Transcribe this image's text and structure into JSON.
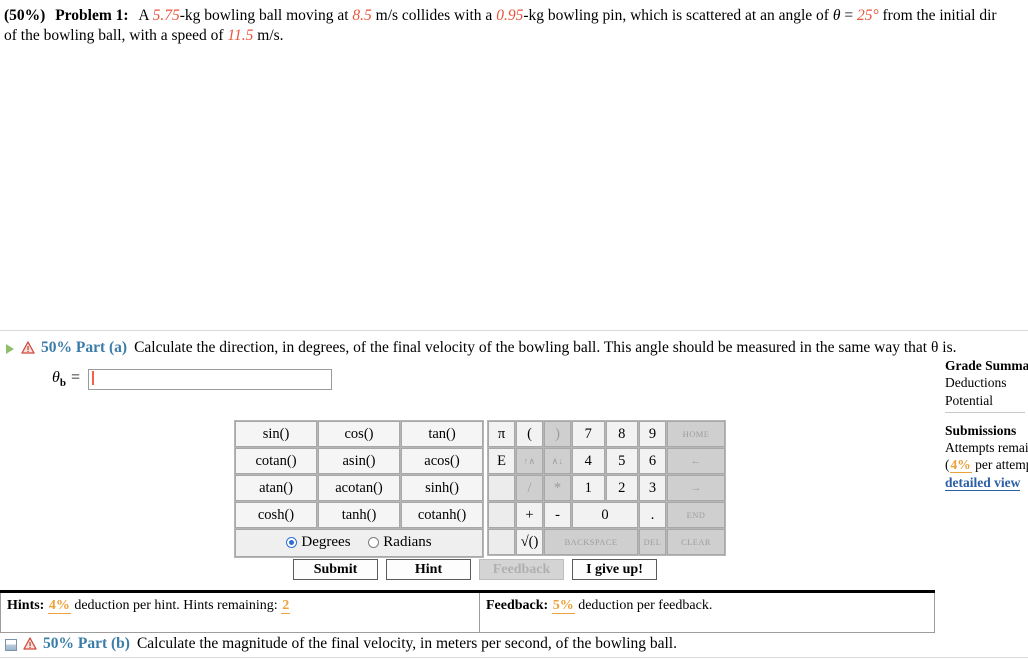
{
  "problem": {
    "weight": "(50%)",
    "title": "Problem 1:",
    "seg1": "A ",
    "v_mass_ball": "5.75",
    "seg2": "-kg bowling ball moving at ",
    "v_speed": "8.5",
    "seg3": " m/s collides with a ",
    "v_mass_pin": "0.95",
    "seg4": "-kg bowling pin, which is scattered at an angle of ",
    "theta_sym": "θ",
    "eq": " = ",
    "v_angle": "25°",
    "seg5": " from the initial dir",
    "line2a": "of the bowling ball, with a speed of ",
    "v_pin_speed": "11.5",
    "line2b": " m/s."
  },
  "part_a": {
    "icon_expand": "triangle-right-icon",
    "icon_warn": "warning-icon",
    "label": "50% Part (a)",
    "text": "Calculate the direction, in degrees, of the final velocity of the bowling ball. This angle should be measured in the same way that θ is.",
    "var_name": "θ",
    "var_sub": "b",
    "var_eq": "=",
    "input_value": "",
    "input_placeholder": ""
  },
  "part_b": {
    "icon_collapse": "square-icon",
    "icon_warn": "warning-icon",
    "label": "50% Part (b)",
    "text": "Calculate the magnitude of the final velocity, in meters per second, of the bowling ball."
  },
  "calculator": {
    "functions": [
      [
        "sin()",
        "cos()",
        "tan()"
      ],
      [
        "cotan()",
        "asin()",
        "acos()"
      ],
      [
        "atan()",
        "acotan()",
        "sinh()"
      ],
      [
        "cosh()",
        "tanh()",
        "cotanh()"
      ]
    ],
    "mode_degrees": "Degrees",
    "mode_radians": "Radians",
    "mode_selected": "Degrees",
    "keypad": {
      "r1": [
        "π",
        "(",
        ")",
        "7",
        "8",
        "9",
        "HOME"
      ],
      "r2": [
        "E",
        "↑∧",
        "∧↓",
        "4",
        "5",
        "6",
        "←"
      ],
      "r3": [
        "",
        "/",
        "*",
        "1",
        "2",
        "3",
        "→"
      ],
      "r4": [
        "",
        "+",
        "-",
        "0",
        ".",
        "END"
      ],
      "r5": [
        "",
        "√()",
        "BACKSPACE",
        "DEL",
        "CLEAR"
      ]
    }
  },
  "actions": {
    "submit": "Submit",
    "hint": "Hint",
    "feedback": "Feedback",
    "give_up": "I give up!"
  },
  "hints_bar": {
    "hints_title": "Hints:",
    "hints_pct": "4%",
    "hints_mid": "deduction per hint. Hints remaining:",
    "hints_remaining": "2",
    "feedback_title": "Feedback:",
    "feedback_pct": "5%",
    "feedback_mid": "deduction per feedback."
  },
  "grade_panel": {
    "grade_title": "Grade Summa",
    "deductions": "Deductions",
    "potential": "Potential",
    "submissions_title": "Submissions",
    "attempts": "Attempts remai",
    "paren_open": "(",
    "attempt_pct": "4%",
    "per_attempt": " per attemp",
    "detailed_view": "detailed view"
  },
  "colors": {
    "accent_number": "#e8553c",
    "part_label": "#3a7ca8",
    "pct_orange": "#eda13a",
    "link_blue": "#2b5fa8",
    "radio_blue": "#2f6fd0"
  }
}
